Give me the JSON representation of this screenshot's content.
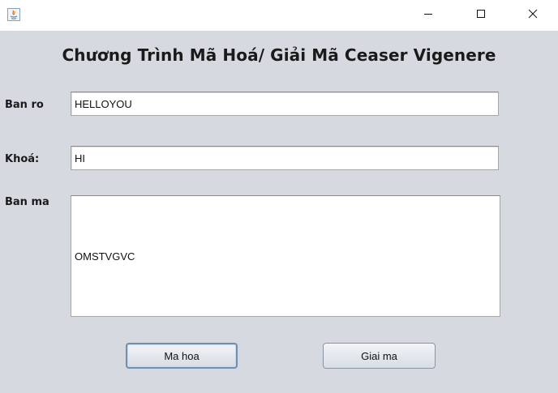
{
  "window": {
    "app_icon": "java-icon",
    "controls": {
      "minimize": "minimize-icon",
      "maximize": "maximize-icon",
      "close": "close-icon"
    }
  },
  "heading": "Chương Trình Mã Hoá/ Giải Mã Ceaser Vigenere",
  "form": {
    "plaintext": {
      "label": "Ban ro",
      "value": "HELLOYOU"
    },
    "key": {
      "label": "Khoá:",
      "value": "HI"
    },
    "ciphertext": {
      "label": "Ban ma",
      "value": "OMSTVGVC"
    }
  },
  "buttons": {
    "encrypt": "Ma hoa",
    "decrypt": "Giai ma"
  },
  "colors": {
    "background": "#d6d9df",
    "titlebar": "#ffffff",
    "focus_border": "#6f8fb3"
  }
}
